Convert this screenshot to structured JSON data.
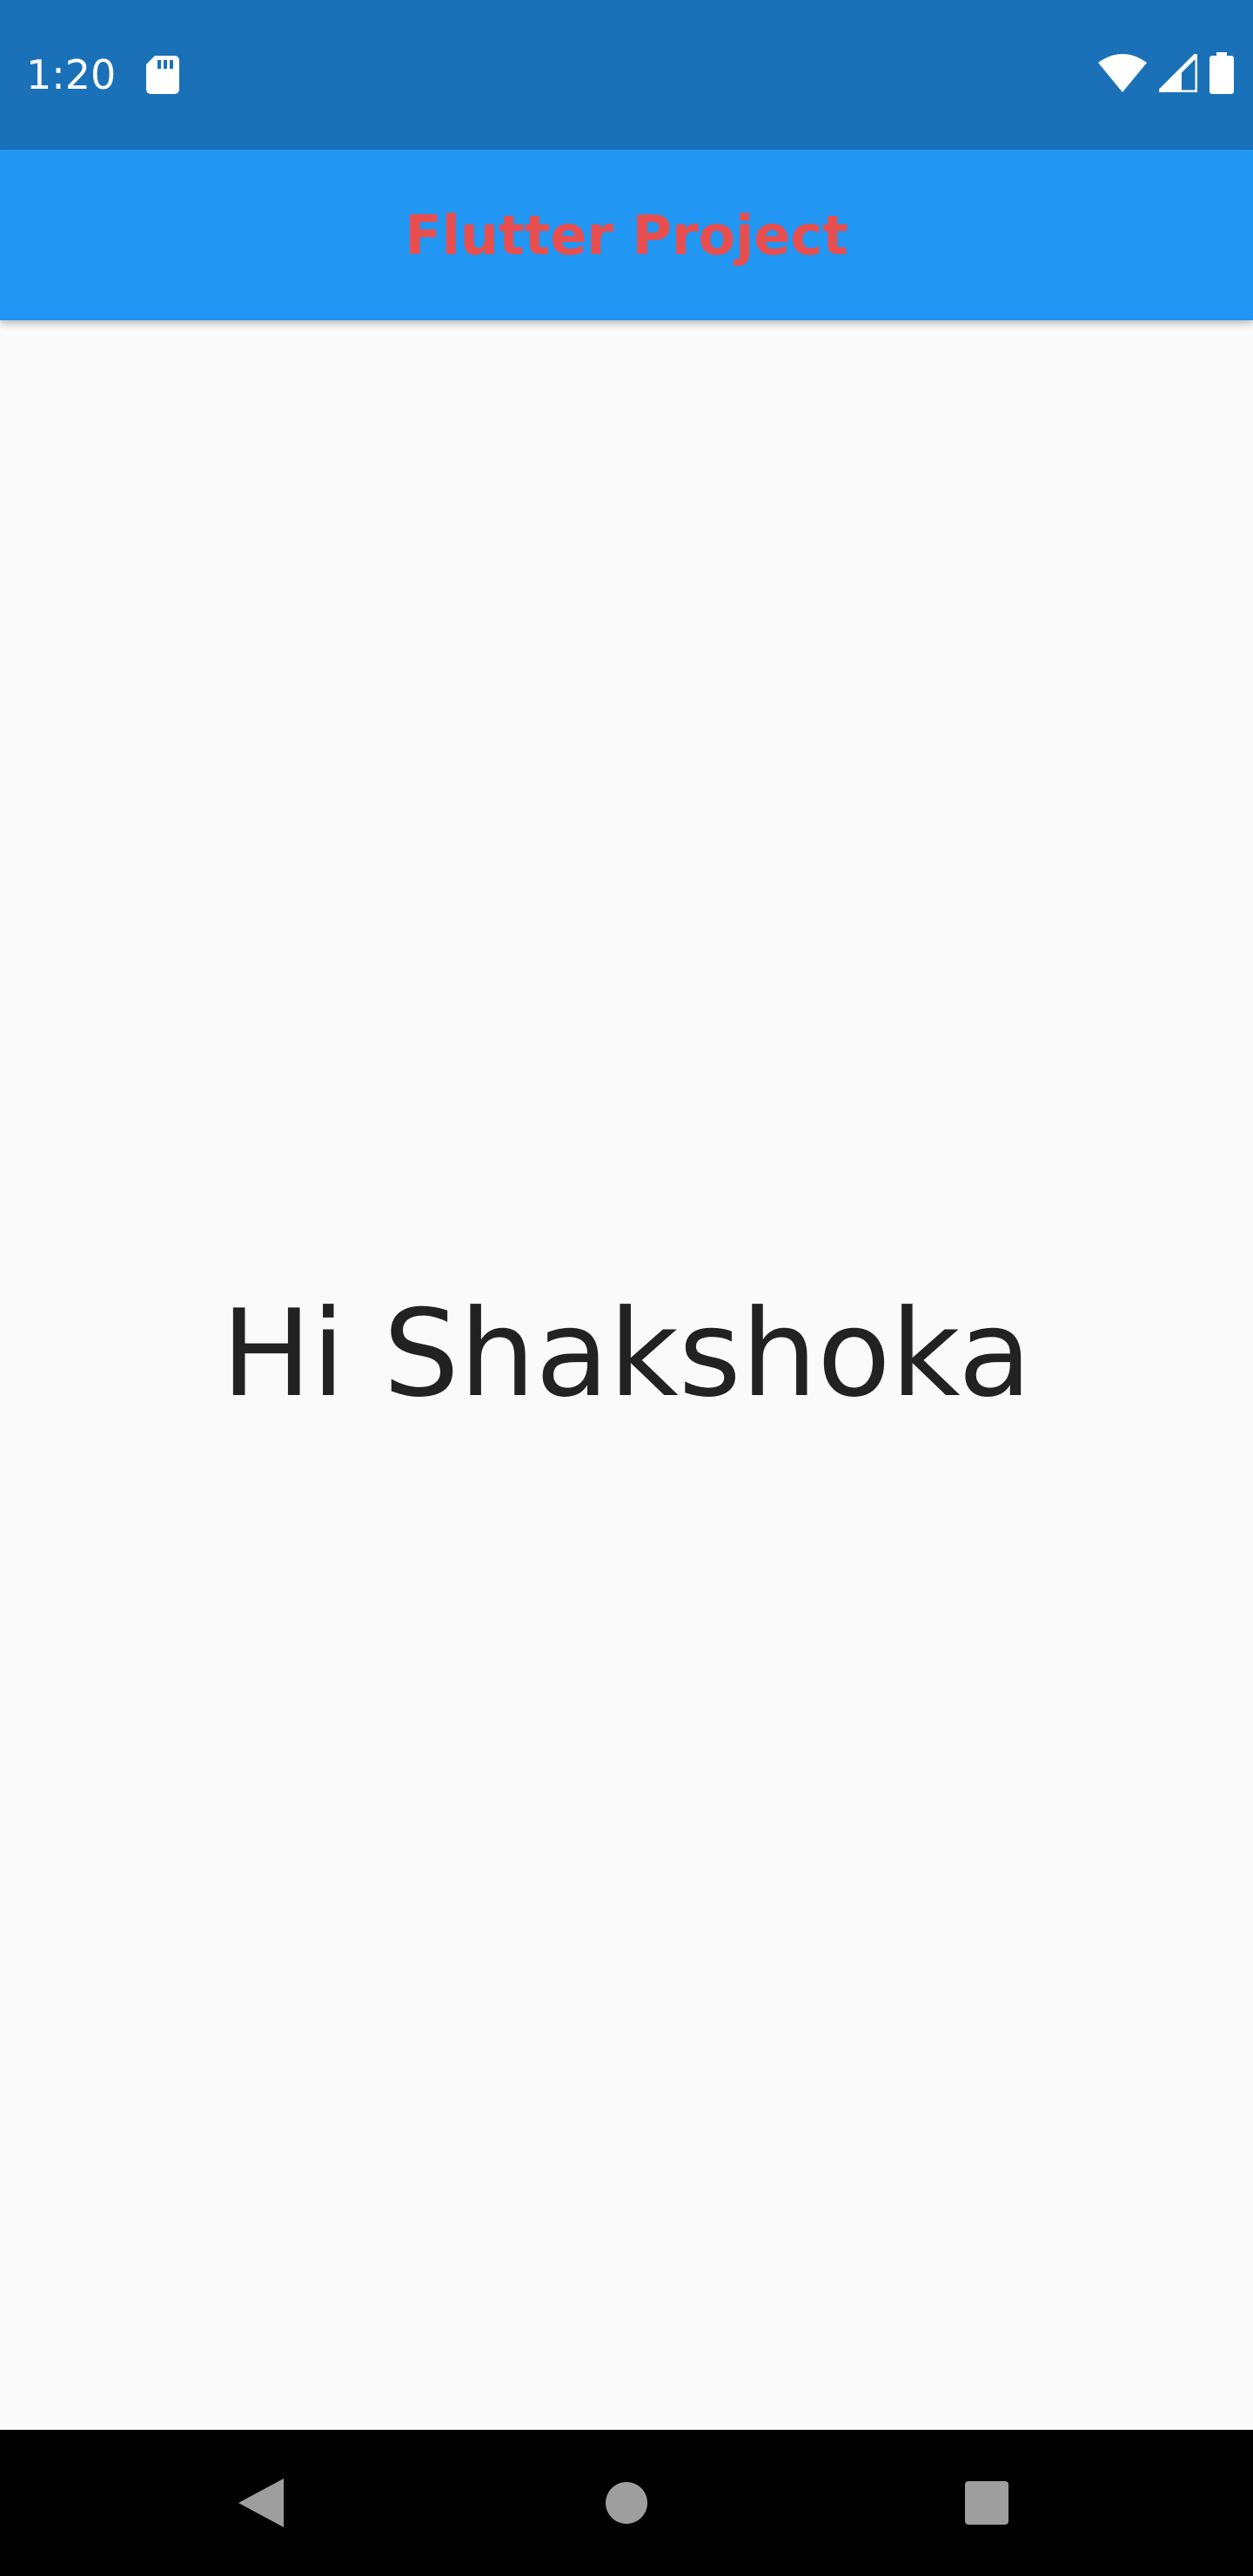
{
  "status_bar": {
    "time": "1:20",
    "icons": [
      "sd-card-icon",
      "wifi-icon",
      "signal-icon",
      "battery-icon"
    ],
    "background": "#1a71b8"
  },
  "app_bar": {
    "title": "Flutter Project",
    "background": "#2196f3",
    "title_color": "#ea4f4f"
  },
  "main": {
    "greeting": "Hi Shakshoka"
  },
  "nav_bar": {
    "buttons": [
      "back-icon",
      "home-icon",
      "recents-icon"
    ]
  }
}
